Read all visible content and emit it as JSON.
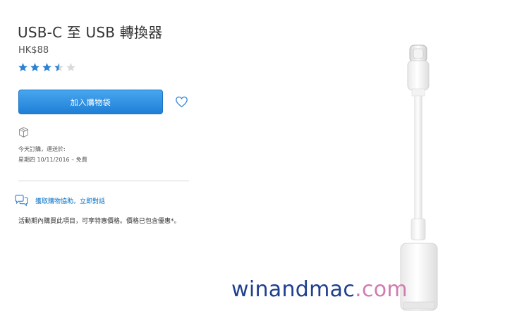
{
  "product": {
    "title": "USB-C 至 USB 轉換器",
    "price": "HK$88",
    "rating": 3.5,
    "rating_max": 5
  },
  "actions": {
    "add_to_bag": "加入購物袋"
  },
  "shipping": {
    "line1": "今天訂購，運送於:",
    "line2": "星期四 10/11/2016 – 免費"
  },
  "help": {
    "link": "獲取購物協助。立即對話"
  },
  "promo": {
    "text": "活動期內購買此項目，可享特惠價格。價格已包含優惠*。"
  },
  "watermark": {
    "part1": "winandmac",
    "part2": ".com"
  },
  "icons": {
    "star": "star-icon",
    "heart": "heart-icon",
    "box": "box-icon",
    "chat": "chat-icon"
  },
  "colors": {
    "accent": "#0070c9",
    "button": "#2f8fe0",
    "star": "#2a82d6"
  }
}
